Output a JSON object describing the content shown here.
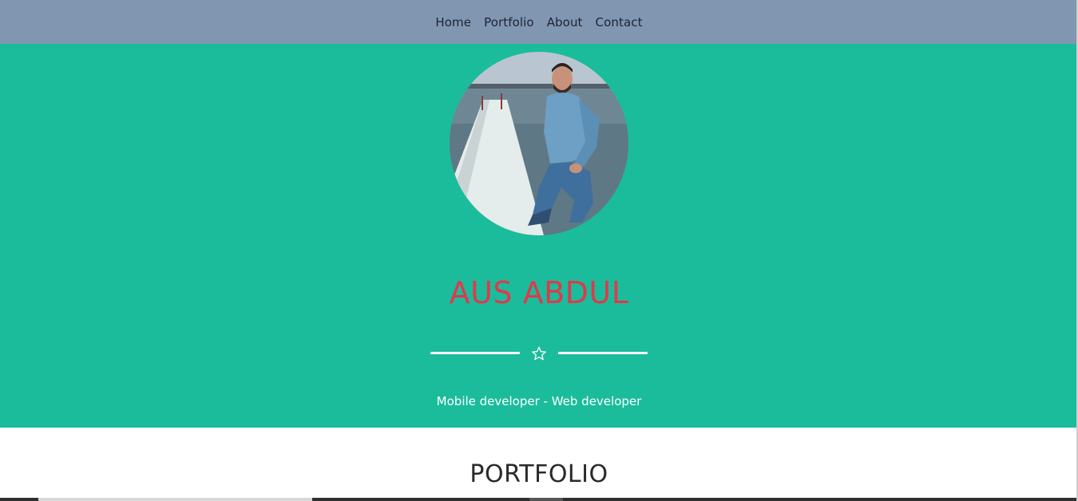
{
  "nav": {
    "items": [
      {
        "label": "Home"
      },
      {
        "label": "Portfolio"
      },
      {
        "label": "About"
      },
      {
        "label": "Contact"
      }
    ]
  },
  "hero": {
    "name": "AUS ABDUL",
    "subtitle": "Mobile developer - Web developer",
    "divider_icon": "star-outline-icon"
  },
  "portfolio": {
    "title": "PORTFOLIO"
  },
  "colors": {
    "navbar": "#8196b1",
    "hero_bg": "#1bbc9b",
    "name": "#e0394b"
  }
}
